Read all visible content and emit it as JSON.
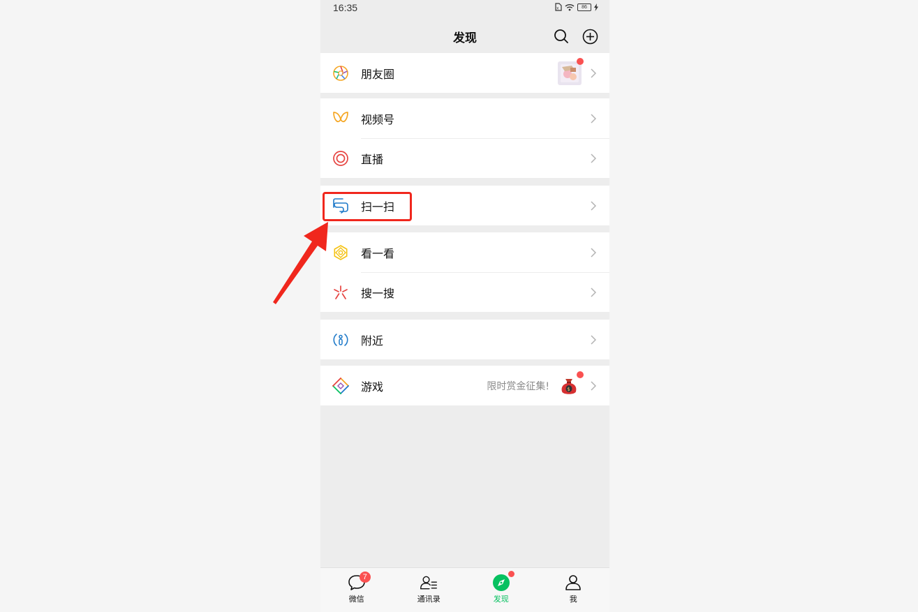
{
  "status_bar": {
    "time": "16:35",
    "battery": "86"
  },
  "header": {
    "title": "发现"
  },
  "menu": {
    "moments": {
      "label": "朋友圈"
    },
    "channels": {
      "label": "视频号"
    },
    "live": {
      "label": "直播"
    },
    "scan": {
      "label": "扫一扫"
    },
    "top_stories": {
      "label": "看一看"
    },
    "search": {
      "label": "搜一搜"
    },
    "nearby": {
      "label": "附近"
    },
    "games": {
      "label": "游戏",
      "extra": "限时赏金征集!"
    }
  },
  "tabbar": {
    "chats": {
      "label": "微信",
      "badge": "7"
    },
    "contacts": {
      "label": "通讯录"
    },
    "discover": {
      "label": "发现"
    },
    "me": {
      "label": "我"
    }
  },
  "colors": {
    "accent": "#07c160",
    "badge": "#fa5151",
    "highlight": "#f0271d"
  }
}
